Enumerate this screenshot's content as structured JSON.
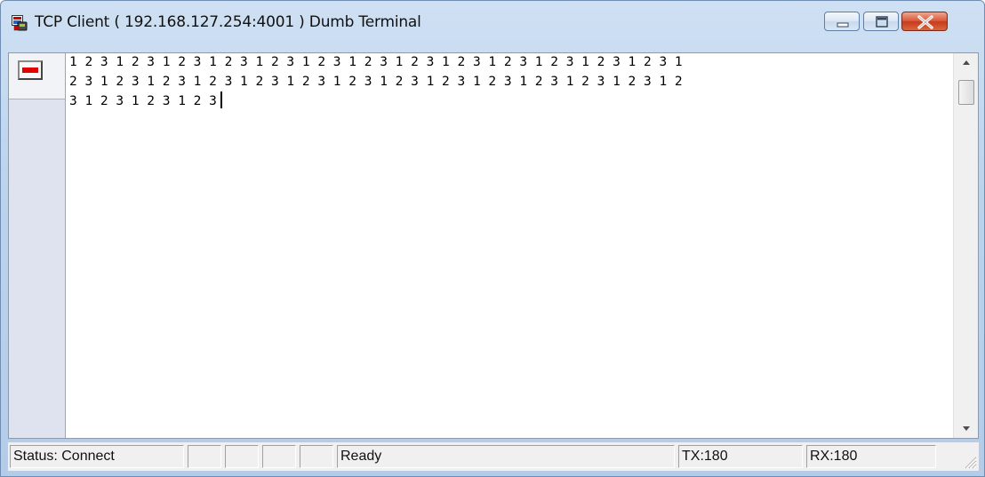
{
  "window": {
    "title": "TCP Client ( 192.168.127.254:4001 ) Dumb Terminal",
    "icon": "tcp-client-app-icon",
    "buttons": [
      "minimize",
      "maximize",
      "close"
    ]
  },
  "toolbar": {
    "connect_button": {
      "icon": "connect-led-icon",
      "state_color": "#e00000"
    }
  },
  "terminal": {
    "lines": [
      "1 2 3 1 2 3 1 2 3 1 2 3 1 2 3 1 2 3 1 2 3 1 2 3 1 2 3 1 2 3 1 2 3 1 2 3 1 2 3 1",
      "2 3 1 2 3 1 2 3 1 2 3 1 2 3 1 2 3 1 2 3 1 2 3 1 2 3 1 2 3 1 2 3 1 2 3 1 2 3 1 2",
      "3 1 2 3 1 2 3 1 2 3"
    ]
  },
  "statusbar": {
    "status": "Status: Connect",
    "empty_panes": [
      "",
      "",
      "",
      ""
    ],
    "state": "Ready",
    "tx": "TX:180",
    "rx": "RX:180"
  },
  "colors": {
    "titlebar": "#bcd3ec",
    "close_button": "#c63b1d",
    "led": "#e00000"
  }
}
